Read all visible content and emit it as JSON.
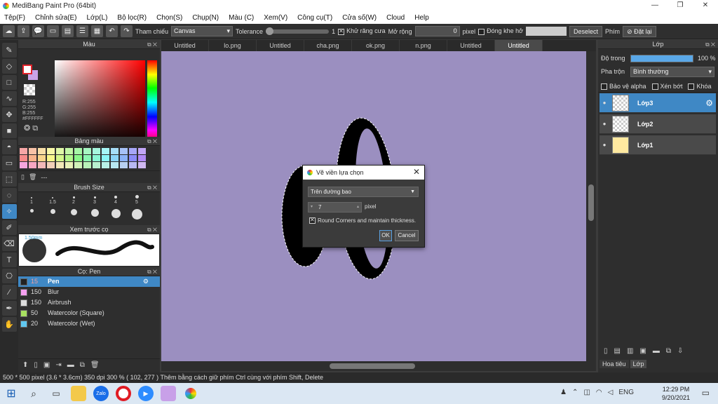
{
  "app": {
    "title": "MediBang Paint Pro (64bit)"
  },
  "menu": [
    "Tệp(F)",
    "Chỉnh sửa(E)",
    "Lớp(L)",
    "Bộ lọc(R)",
    "Chọn(S)",
    "Chụp(N)",
    "Màu (C)",
    "Xem(V)",
    "Công cụ(T)",
    "Cửa số(W)",
    "Cloud",
    "Help"
  ],
  "toolbar": {
    "reference_label": "Tham chiếu",
    "reference_value": "Canvas",
    "tolerance_label": "Tolerance",
    "tolerance_value": "1",
    "antialias_label": "Khử răng cưa",
    "expand_label": "Mở rộng",
    "expand_value": "0",
    "expand_unit": "pixel",
    "close_gap_label": "Đóng khe hở",
    "deselect_label": "Deselect",
    "key_label": "Phím",
    "reset_label": "Đặt lại"
  },
  "left_panel": {
    "color_title": "Màu",
    "rgb": {
      "r": "R:255",
      "g": "G:255",
      "b": "B:255",
      "hex": "#FFFFFF"
    },
    "palette_title": "Bảng màu",
    "palette_footer": "---",
    "palette_colors": [
      "#f7a6a6",
      "#f7c2a6",
      "#f7dea6",
      "#f7f7a6",
      "#def7a6",
      "#c2f7a6",
      "#a6f7a6",
      "#a6f7c2",
      "#a6f7de",
      "#a6f7f7",
      "#a6def7",
      "#a6c2f7",
      "#a6a6f7",
      "#c2a6f7",
      "#f78a8a",
      "#f7b28a",
      "#f7d48a",
      "#f7f78a",
      "#d4f78a",
      "#b2f78a",
      "#8af78a",
      "#8af7b2",
      "#8af7d4",
      "#8af7f7",
      "#8ad4f7",
      "#8ab2f7",
      "#8a8af7",
      "#b28af7",
      "#f7a6de",
      "#f7a6c2",
      "#f2b8b8",
      "#f2d0b8",
      "#f2e8b8",
      "#e8f2b8",
      "#d0f2b8",
      "#b8f2b8",
      "#b8f2d0",
      "#b8f2e8",
      "#b8e8f2",
      "#b8d0f2",
      "#b8b8f2",
      "#d0b8f2"
    ],
    "brush_size_title": "Brush Size",
    "brush_sizes": [
      "1",
      "1.5",
      "2",
      "3",
      "4",
      "5"
    ],
    "preview_title": "Xem trước cọ",
    "preview_size": "1.50mm",
    "brush_title": "Cọ: Pen",
    "brushes": [
      {
        "size": "15",
        "name": "Pen",
        "color": "#222222"
      },
      {
        "size": "150",
        "name": "Blur",
        "color": "#f5a0f0"
      },
      {
        "size": "150",
        "name": "Airbrush",
        "color": "#dddddd"
      },
      {
        "size": "50",
        "name": "Watercolor (Square)",
        "color": "#a8e060"
      },
      {
        "size": "20",
        "name": "Watercolor (Wet)",
        "color": "#60c8f0"
      }
    ]
  },
  "tabs": [
    "Untitled",
    "lo.png",
    "Untitled",
    "cha.png",
    "ok.png",
    "n.png",
    "Untitled",
    "Untitled"
  ],
  "active_tab_index": 7,
  "canvas": {
    "background": "#9b8fc0"
  },
  "dialog": {
    "title": "Vẽ viền lựa chọn",
    "mode": "Trên đường bao",
    "width_value": "7",
    "width_unit": "pixel",
    "round_corners_label": "Round Corners and maintain thickness.",
    "ok_label": "OK",
    "cancel_label": "Cancel"
  },
  "right_panel": {
    "layer_title": "Lớp",
    "opacity_label": "Độ trong",
    "opacity_value": "100 %",
    "opacity_fraction": 1.0,
    "blend_label": "Pha trộn",
    "blend_value": "Bình thường",
    "protect_alpha_label": "Bảo vệ alpha",
    "clip_label": "Xén bớt",
    "lock_label": "Khóa",
    "layers": [
      {
        "name": "Lớp3",
        "selected": true
      },
      {
        "name": "Lớp2",
        "selected": false
      },
      {
        "name": "Lớp1",
        "selected": false
      }
    ],
    "bottom_tabs": [
      "Hoa tiêu",
      "Lớp"
    ]
  },
  "status": {
    "text": "500 * 500 pixel   (3.6 * 3.6cm)   350 dpi   300 %   ( 102, 277 )   Thêm bằng cách giữ phím Ctrl cùng với phím Shift, Delete"
  },
  "taskbar": {
    "lang": "ENG",
    "time": "12:29 PM",
    "date": "9/20/2021"
  }
}
